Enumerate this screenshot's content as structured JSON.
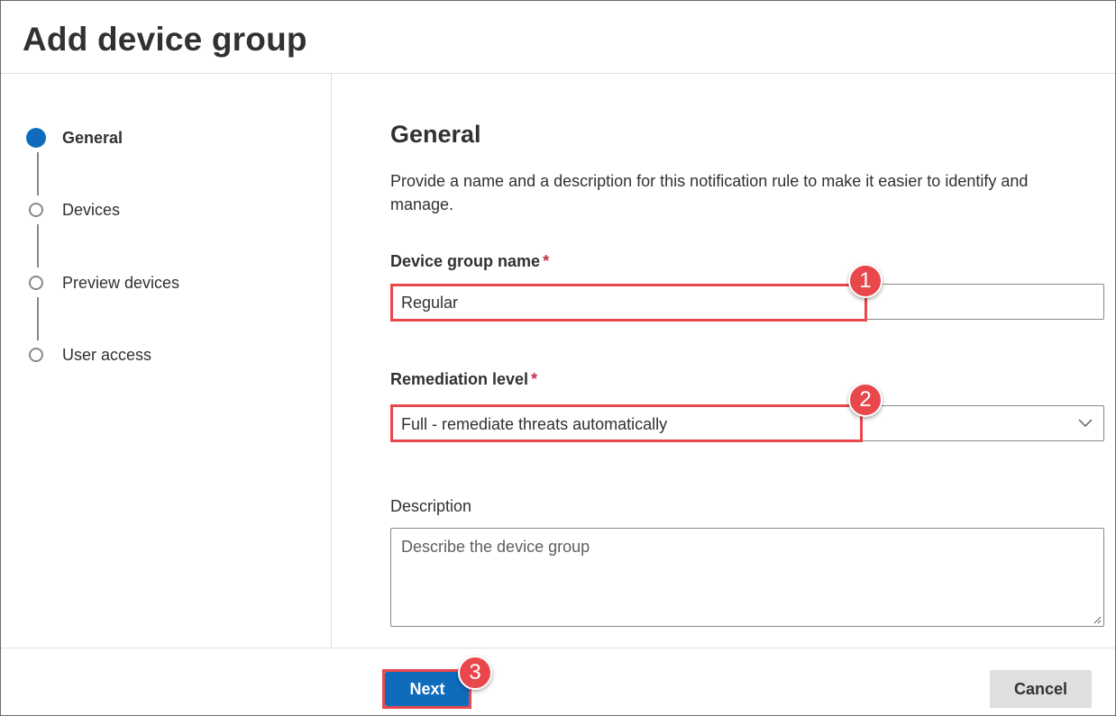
{
  "header": {
    "title": "Add device group"
  },
  "wizard": {
    "steps": [
      {
        "label": "General",
        "state": "current"
      },
      {
        "label": "Devices",
        "state": "pending"
      },
      {
        "label": "Preview devices",
        "state": "pending"
      },
      {
        "label": "User access",
        "state": "pending"
      }
    ]
  },
  "main": {
    "section_title": "General",
    "section_description": "Provide a name and a description for this notification rule to make it easier to identify and manage.",
    "fields": {
      "name": {
        "label": "Device group name",
        "required_marker": "*",
        "value": "Regular"
      },
      "remediation": {
        "label": "Remediation level",
        "required_marker": "*",
        "value": "Full - remediate threats automatically",
        "icon": "chevron-down-icon"
      },
      "description": {
        "label": "Description",
        "placeholder": "Describe the device group",
        "value": ""
      }
    }
  },
  "footer": {
    "next_label": "Next",
    "cancel_label": "Cancel"
  },
  "annotations": {
    "badges": [
      "1",
      "2",
      "3"
    ]
  },
  "colors": {
    "accent": "#0f6cbd",
    "highlight": "#e8474c",
    "required": "#c4314b",
    "secondary_button": "#e1dfdd"
  }
}
